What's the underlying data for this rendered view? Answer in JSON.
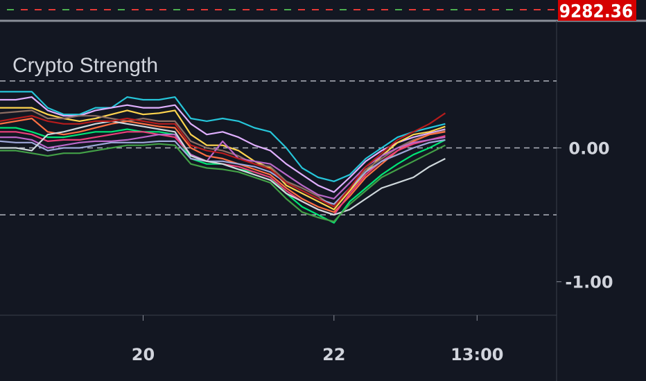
{
  "chart_data": {
    "type": "line",
    "title": "Crypto Strength",
    "price_label": "9282.36",
    "ylim": [
      -1.25,
      0.95
    ],
    "yticks": [
      {
        "value": 0,
        "label": "0.00"
      },
      {
        "value": -1,
        "label": "-1.00"
      }
    ],
    "hlines": [
      0.5,
      0,
      -0.5
    ],
    "xlim": [
      0,
      35
    ],
    "xticks": [
      {
        "value": 9,
        "label": "20"
      },
      {
        "value": 21,
        "label": "22"
      },
      {
        "value": 30,
        "label": "13:00"
      }
    ],
    "x": [
      0,
      1,
      2,
      3,
      4,
      5,
      6,
      7,
      8,
      9,
      10,
      11,
      12,
      13,
      14,
      15,
      16,
      17,
      18,
      19,
      20,
      21,
      22,
      23,
      24,
      25,
      26,
      27,
      28
    ],
    "series": [
      {
        "color": "#26c6da",
        "values": [
          0.42,
          0.42,
          0.42,
          0.3,
          0.25,
          0.25,
          0.3,
          0.3,
          0.38,
          0.36,
          0.36,
          0.38,
          0.22,
          0.2,
          0.22,
          0.2,
          0.15,
          0.12,
          0.0,
          -0.15,
          -0.22,
          -0.25,
          -0.2,
          -0.08,
          0.0,
          0.08,
          0.12,
          0.15,
          0.18
        ]
      },
      {
        "color": "#e0b0ff",
        "values": [
          0.36,
          0.36,
          0.38,
          0.28,
          0.24,
          0.24,
          0.28,
          0.3,
          0.32,
          0.3,
          0.3,
          0.32,
          0.18,
          0.1,
          0.12,
          0.08,
          0.02,
          -0.02,
          -0.12,
          -0.2,
          -0.28,
          -0.33,
          -0.22,
          -0.1,
          -0.02,
          0.04,
          0.08,
          0.11,
          0.14
        ]
      },
      {
        "color": "#ffd54f",
        "values": [
          0.3,
          0.3,
          0.3,
          0.25,
          0.22,
          0.2,
          0.22,
          0.25,
          0.28,
          0.25,
          0.26,
          0.28,
          0.1,
          0.02,
          0.02,
          -0.02,
          -0.1,
          -0.15,
          -0.28,
          -0.34,
          -0.4,
          -0.46,
          -0.32,
          -0.18,
          -0.06,
          0.04,
          0.1,
          0.12,
          0.16
        ]
      },
      {
        "color": "#8d6e63",
        "values": [
          0.26,
          0.27,
          0.28,
          0.22,
          0.22,
          0.24,
          0.24,
          0.22,
          0.2,
          0.22,
          0.2,
          0.2,
          0.05,
          0.0,
          -0.02,
          -0.06,
          -0.12,
          -0.14,
          -0.25,
          -0.3,
          -0.36,
          -0.44,
          -0.3,
          -0.16,
          -0.08,
          0.0,
          0.06,
          0.1,
          0.13
        ]
      },
      {
        "color": "#ff7043",
        "values": [
          0.18,
          0.2,
          0.22,
          0.12,
          0.1,
          0.12,
          0.15,
          0.18,
          0.2,
          0.18,
          0.16,
          0.15,
          0.0,
          -0.06,
          -0.08,
          -0.12,
          -0.16,
          -0.2,
          -0.3,
          -0.38,
          -0.44,
          -0.48,
          -0.36,
          -0.22,
          -0.12,
          -0.02,
          0.05,
          0.1,
          0.12
        ]
      },
      {
        "color": "#00e676",
        "values": [
          0.15,
          0.15,
          0.12,
          0.08,
          0.08,
          0.1,
          0.12,
          0.12,
          0.14,
          0.12,
          0.12,
          0.1,
          -0.08,
          -0.12,
          -0.12,
          -0.16,
          -0.18,
          -0.22,
          -0.34,
          -0.44,
          -0.5,
          -0.56,
          -0.4,
          -0.3,
          -0.2,
          -0.12,
          -0.05,
          0.0,
          0.06
        ]
      },
      {
        "color": "#ec407a",
        "values": [
          0.12,
          0.12,
          0.1,
          0.05,
          0.06,
          0.06,
          0.08,
          0.1,
          0.12,
          0.12,
          0.1,
          0.08,
          -0.05,
          -0.1,
          -0.12,
          -0.14,
          -0.18,
          -0.22,
          -0.32,
          -0.4,
          -0.46,
          -0.5,
          -0.34,
          -0.2,
          -0.1,
          -0.02,
          0.03,
          0.06,
          0.09
        ]
      },
      {
        "color": "#ba68c8",
        "values": [
          0.08,
          0.08,
          0.06,
          0.0,
          0.02,
          0.04,
          0.05,
          0.05,
          0.06,
          0.08,
          0.1,
          0.1,
          -0.05,
          -0.1,
          0.05,
          -0.08,
          -0.1,
          -0.12,
          -0.2,
          -0.28,
          -0.35,
          -0.38,
          -0.26,
          -0.14,
          -0.06,
          0.0,
          0.04,
          0.06,
          0.08
        ]
      },
      {
        "color": "#9fa8da",
        "values": [
          0.05,
          0.04,
          0.04,
          -0.02,
          0.0,
          0.0,
          0.02,
          0.04,
          0.04,
          0.04,
          0.05,
          0.05,
          -0.08,
          -0.1,
          -0.1,
          -0.12,
          -0.14,
          -0.18,
          -0.26,
          -0.32,
          -0.38,
          -0.42,
          -0.3,
          -0.18,
          -0.1,
          -0.05,
          0.0,
          0.04,
          0.06
        ]
      },
      {
        "color": "#cfd8dc",
        "values": [
          0.0,
          0.0,
          -0.02,
          0.1,
          0.12,
          0.15,
          0.18,
          0.2,
          0.18,
          0.16,
          0.14,
          0.12,
          -0.06,
          -0.1,
          -0.12,
          -0.16,
          -0.2,
          -0.24,
          -0.34,
          -0.4,
          -0.46,
          -0.5,
          -0.46,
          -0.38,
          -0.3,
          -0.26,
          -0.22,
          -0.14,
          -0.08
        ]
      },
      {
        "color": "#43a047",
        "values": [
          -0.02,
          -0.02,
          -0.04,
          -0.06,
          -0.04,
          -0.04,
          -0.02,
          0.0,
          0.02,
          0.02,
          0.03,
          0.02,
          -0.12,
          -0.15,
          -0.16,
          -0.18,
          -0.22,
          -0.26,
          -0.38,
          -0.48,
          -0.52,
          -0.55,
          -0.42,
          -0.32,
          -0.22,
          -0.16,
          -0.1,
          -0.04,
          0.02
        ]
      },
      {
        "color": "#b71c1c",
        "values": [
          0.2,
          0.22,
          0.24,
          0.2,
          0.18,
          0.18,
          0.2,
          0.2,
          0.22,
          0.2,
          0.18,
          0.18,
          0.02,
          -0.02,
          -0.04,
          -0.08,
          -0.12,
          -0.16,
          -0.26,
          -0.32,
          -0.38,
          -0.44,
          -0.3,
          -0.14,
          -0.04,
          0.06,
          0.12,
          0.18,
          0.26
        ]
      }
    ]
  }
}
